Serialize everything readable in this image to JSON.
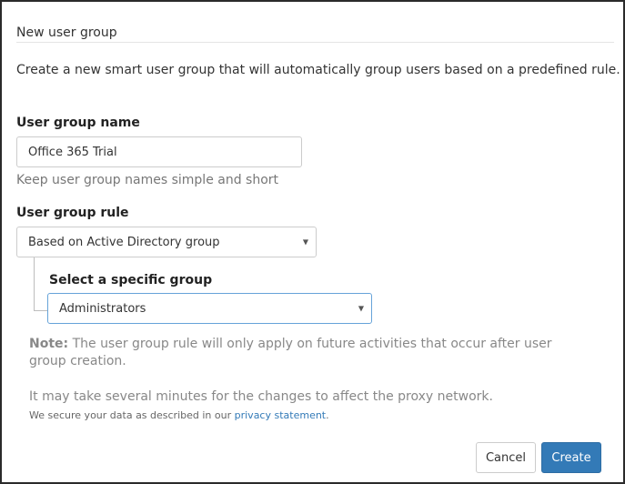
{
  "dialog": {
    "title": "New user group",
    "intro": "Create a new smart user group that will automatically group users based on a predefined rule."
  },
  "form": {
    "name_label": "User group name",
    "name_value": "Office 365 Trial",
    "name_hint": "Keep user group names simple and short",
    "rule_label": "User group rule",
    "rule_selected": "Based on Active Directory group",
    "group_label": "Select a specific group",
    "group_selected": "Administrators"
  },
  "notes": {
    "note_prefix": "Note:",
    "note_text": " The user group rule will only apply on future activities that occur after user group creation.",
    "minutes_text": "It may take several minutes for the changes to affect the proxy network.",
    "secure_text": "We secure your data as described in our ",
    "privacy_link": "privacy statement",
    "secure_suffix": "."
  },
  "buttons": {
    "cancel": "Cancel",
    "create": "Create"
  },
  "icons": {
    "select_caret": "caret-down-icon"
  },
  "colors": {
    "primary": "#337ab7",
    "link": "#337ab7",
    "focus_border": "#66a3d9"
  }
}
